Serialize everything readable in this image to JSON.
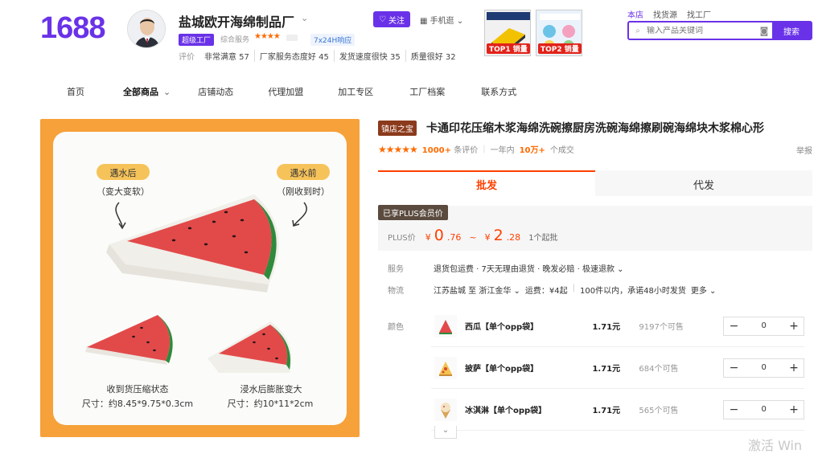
{
  "header": {
    "logo": "1688",
    "shop_name": "盐城欧开海绵制品厂",
    "factory_badge": "超级工厂",
    "service_label": "综合服务",
    "service_stars": "★★★★",
    "reply_badge": "7x24H响应",
    "follow_label": "关注",
    "mobile_label": "手机逛",
    "ratings": [
      "评价",
      "非常满意 57",
      "厂家服务态度好 45",
      "发货速度很快 35",
      "质量很好 32"
    ],
    "top_tags": [
      "TOP1 销量",
      "TOP2 销量"
    ]
  },
  "search": {
    "tabs": [
      "本店",
      "找货源",
      "找工厂"
    ],
    "placeholder": "输入产品关键词",
    "button": "搜索"
  },
  "nav": {
    "items": [
      "首页",
      "全部商品",
      "店铺动态",
      "代理加盟",
      "加工专区",
      "工厂档案",
      "联系方式"
    ]
  },
  "gallery": {
    "label_after_water": "遇水后",
    "sub_after_water": "（变大变软）",
    "label_before_water": "遇水前",
    "sub_before_water": "（刚收到时）",
    "caption_left_1": "收到货压缩状态",
    "caption_left_2": "尺寸：约8.45*9.75*0.3cm",
    "caption_right_1": "浸水后膨胀变大",
    "caption_right_2": "尺寸：约10*11*2cm"
  },
  "product": {
    "tag": "镇店之宝",
    "title": "卡通印花压缩木浆海绵洗碗擦厨房洗碗海绵擦刷碗海绵块木浆棉心形",
    "stars": "★★★★★",
    "review_count": "1000+",
    "review_suffix": "条评价",
    "period": "一年内",
    "sold_count": "10万+",
    "sold_suffix": "个成交",
    "report": "举报"
  },
  "tabs": {
    "wholesale": "批发",
    "dropship": "代发"
  },
  "price": {
    "plus_tag": "已享PLUS会员价",
    "plus_label": "PLUS价",
    "currency": "¥",
    "low_int": "0",
    "low_dec": ".76",
    "tilde": "~",
    "high_int": "2",
    "high_dec": ".28",
    "moq": "1个起批"
  },
  "service": {
    "label": "服务",
    "value": "退货包运费 · 7天无理由退货 · 晚发必赔 · 极速退款 ⌄"
  },
  "logistics": {
    "label": "物流",
    "route": "江苏盐城 至 浙江金华 ⌄",
    "fee": "运费：¥4起",
    "promise": "100件以内，承诺48小时发货",
    "more": "更多 ⌄"
  },
  "colors": {
    "label": "颜色",
    "variants": [
      {
        "name": "西瓜【单个opp袋】",
        "price": "1.71元",
        "stock": "9197个可售",
        "qty": "0"
      },
      {
        "name": "披萨【单个opp袋】",
        "price": "1.71元",
        "stock": "684个可售",
        "qty": "0"
      },
      {
        "name": "冰淇淋【单个opp袋】",
        "price": "1.71元",
        "stock": "565个可售",
        "qty": "0"
      }
    ]
  },
  "watermark": "激活 Win",
  "theme": {
    "brand": "#6a32e8",
    "price": "#ff4000",
    "orange_bg": "#f6a13a",
    "star": "#ff6a00"
  }
}
